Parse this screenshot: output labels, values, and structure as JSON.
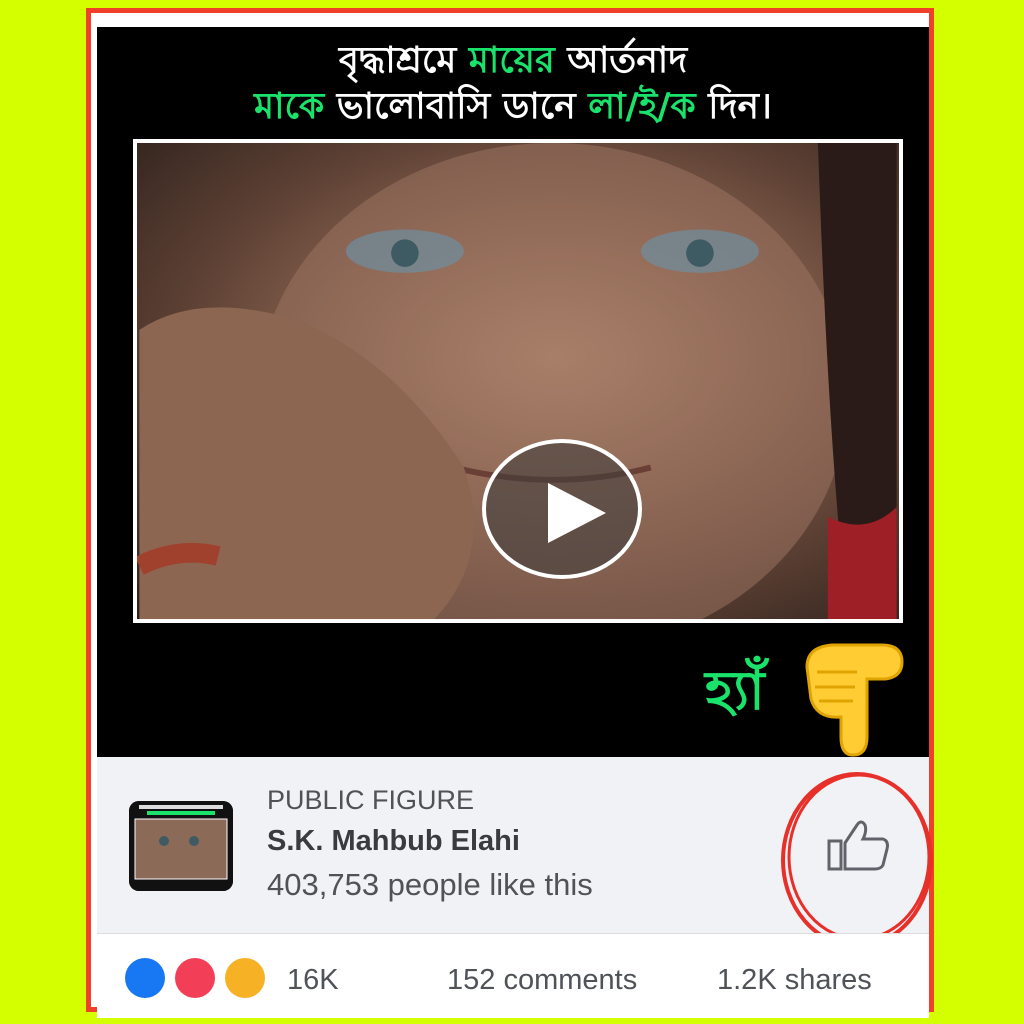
{
  "headline": {
    "line1_part1": "বৃদ্ধাশ্রমে ",
    "line1_part2": "মায়ের",
    "line1_part3": " আর্তনাদ",
    "line2_part1": "মাকে",
    "line2_part2": " ভালোবাসি ডানে ",
    "line2_part3": "লা/ই/ক",
    "line2_part4": " দিন।"
  },
  "overlay": {
    "yes_text": "হ্যাঁ"
  },
  "page": {
    "category": "PUBLIC FIGURE",
    "name": "S.K. Mahbub Elahi",
    "likes_text": "403,753 people like this"
  },
  "engagement": {
    "reactions_count": "16K",
    "comments": "152 comments",
    "shares": "1.2K shares"
  },
  "icons": {
    "play": "play-icon",
    "thumb": "thumbs-up-icon",
    "pointer": "pointing-down-hand-icon"
  },
  "colors": {
    "background": "#d4ff00",
    "frame": "#f0402a",
    "accent_green": "#19e36a",
    "facebook_blue": "#1877f2"
  }
}
